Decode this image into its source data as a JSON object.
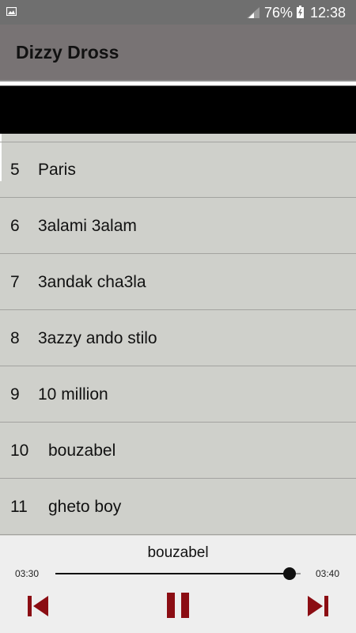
{
  "status_bar": {
    "battery_percent": "76%",
    "time": "12:38",
    "icons": [
      "image-notification-icon",
      "signal-icon",
      "battery-charging-icon"
    ]
  },
  "app_bar": {
    "title": "Dizzy Dross",
    "background_color": "#787374"
  },
  "tracks": [
    {
      "number": "5",
      "title": "Paris"
    },
    {
      "number": "6",
      "title": "3alami 3alam"
    },
    {
      "number": "7",
      "title": "3andak cha3la"
    },
    {
      "number": "8",
      "title": "3azzy ando stilo"
    },
    {
      "number": "9",
      "title": "10 million"
    },
    {
      "number": "10",
      "title": "bouzabel"
    },
    {
      "number": "11",
      "title": "gheto boy"
    }
  ],
  "player": {
    "now_playing": "bouzabel",
    "current_time": "03:30",
    "total_time": "03:40",
    "progress_fraction": 0.955,
    "controls": [
      "previous-icon",
      "pause-icon",
      "next-icon"
    ],
    "control_color": "#8b0d13"
  }
}
